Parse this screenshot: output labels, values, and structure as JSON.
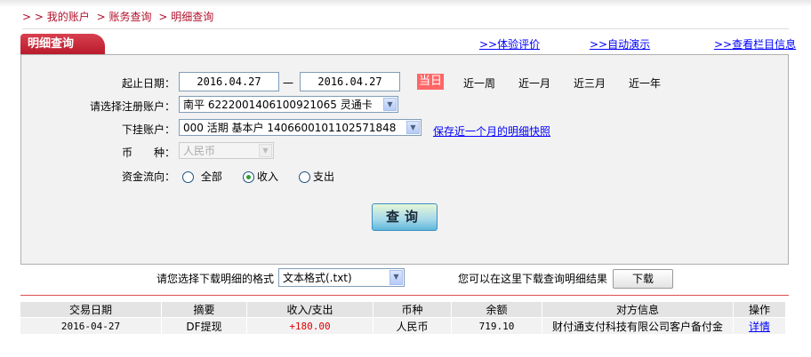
{
  "breadcrumb": {
    "prefix": "> >",
    "items": [
      "我的账户",
      "账务查询",
      "明细查询"
    ],
    "sep": ">"
  },
  "tab": {
    "title": "明细查询"
  },
  "top_links": [
    ">>体验评价",
    ">>自动演示",
    ">>查看栏目信息"
  ],
  "form": {
    "date_label": "起止日期：",
    "date_start": "2016.04.27",
    "date_dash": "一",
    "date_end": "2016.04.27",
    "quick_dates": [
      "当日",
      "近一周",
      "近一月",
      "近三月",
      "近一年"
    ],
    "quick_active": "当日",
    "reg_account_label": "请选择注册账户：",
    "reg_account_value": "南平 6222001406100921065 灵通卡",
    "sub_account_label": "下挂账户：",
    "sub_account_value": "000 活期 基本户 1406600101102571848",
    "snapshot_link": "保存近一个月的明细快照",
    "currency_label": "币　　种：",
    "currency_value": "人民币",
    "flow_label": "资金流向：",
    "flow_options": [
      "全部",
      "收入",
      "支出"
    ],
    "flow_selected": "收入",
    "query_button": "查询"
  },
  "download": {
    "format_label": "请您选择下载明细的格式",
    "format_value": "文本格式(.txt)",
    "hint": "您可以在这里下载查询明细结果",
    "button": "下载"
  },
  "table": {
    "headers": [
      "交易日期",
      "摘要",
      "收入/支出",
      "币种",
      "余额",
      "对方信息",
      "操作"
    ],
    "rows": [
      [
        "2016-04-27",
        "DF提现",
        "+180.00",
        "人民币",
        "719.10",
        "财付通支付科技有限公司客户备付金",
        "详情"
      ]
    ]
  },
  "colors": {
    "accent": "#b81a2a",
    "active_date": "#ff6666",
    "income": "#e00000",
    "link": "#0000ff"
  }
}
